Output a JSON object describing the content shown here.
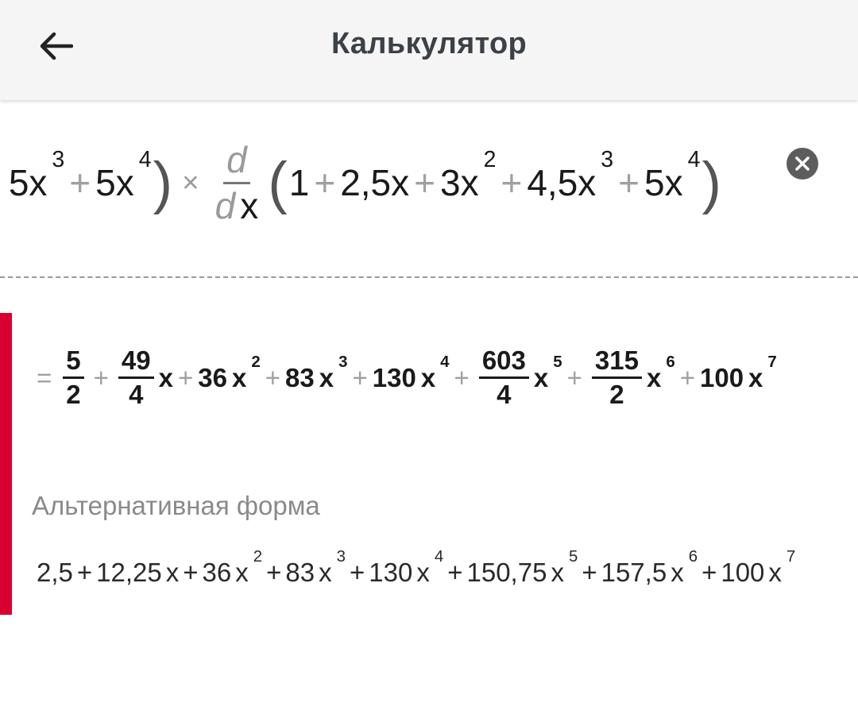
{
  "header": {
    "title": "Калькулятор",
    "back_icon": "arrow-left-icon"
  },
  "input": {
    "left_terms": [
      {
        "coef": "5x",
        "exp": "3"
      },
      {
        "coef": "5x",
        "exp": "4"
      }
    ],
    "deriv": {
      "d": "d",
      "dx_d": "d",
      "dx_x": "x"
    },
    "inner_terms": [
      {
        "coef": "1",
        "exp": ""
      },
      {
        "coef": "2,5x",
        "exp": ""
      },
      {
        "coef": "3x",
        "exp": "2"
      },
      {
        "coef": "4,5x",
        "exp": "3"
      },
      {
        "coef": "5x",
        "exp": "4"
      }
    ],
    "plus": "+",
    "times": "×",
    "open_paren": "(",
    "close_paren": ")",
    "clear_icon": "clear-circle-icon"
  },
  "result": {
    "equals": "=",
    "plus": "+",
    "terms": [
      {
        "kind": "frac",
        "num": "5",
        "den": "2",
        "var": "",
        "exp": ""
      },
      {
        "kind": "frac",
        "num": "49",
        "den": "4",
        "var": "x",
        "exp": ""
      },
      {
        "kind": "plain",
        "coef": "36",
        "var": "x",
        "exp": "2"
      },
      {
        "kind": "plain",
        "coef": "83",
        "var": "x",
        "exp": "3"
      },
      {
        "kind": "plain",
        "coef": "130",
        "var": "x",
        "exp": "4"
      },
      {
        "kind": "frac",
        "num": "603",
        "den": "4",
        "var": "x",
        "exp": "5"
      },
      {
        "kind": "frac",
        "num": "315",
        "den": "2",
        "var": "x",
        "exp": "6"
      },
      {
        "kind": "plain",
        "coef": "100",
        "var": "x",
        "exp": "7"
      }
    ]
  },
  "alternative": {
    "heading": "Альтернативная форма",
    "plus": "+",
    "terms": [
      {
        "coef": "2,5",
        "var": "",
        "exp": ""
      },
      {
        "coef": "12,25",
        "var": "x",
        "exp": ""
      },
      {
        "coef": "36",
        "var": "x",
        "exp": "2"
      },
      {
        "coef": "83",
        "var": "x",
        "exp": "3"
      },
      {
        "coef": "130",
        "var": "x",
        "exp": "4"
      },
      {
        "coef": "150,75",
        "var": "x",
        "exp": "5"
      },
      {
        "coef": "157,5",
        "var": "x",
        "exp": "6"
      },
      {
        "coef": "100",
        "var": "x",
        "exp": "7"
      }
    ]
  },
  "colors": {
    "accent": "#d80030",
    "operator": "#a0a0a0",
    "appbar": "#f5f5f5"
  }
}
